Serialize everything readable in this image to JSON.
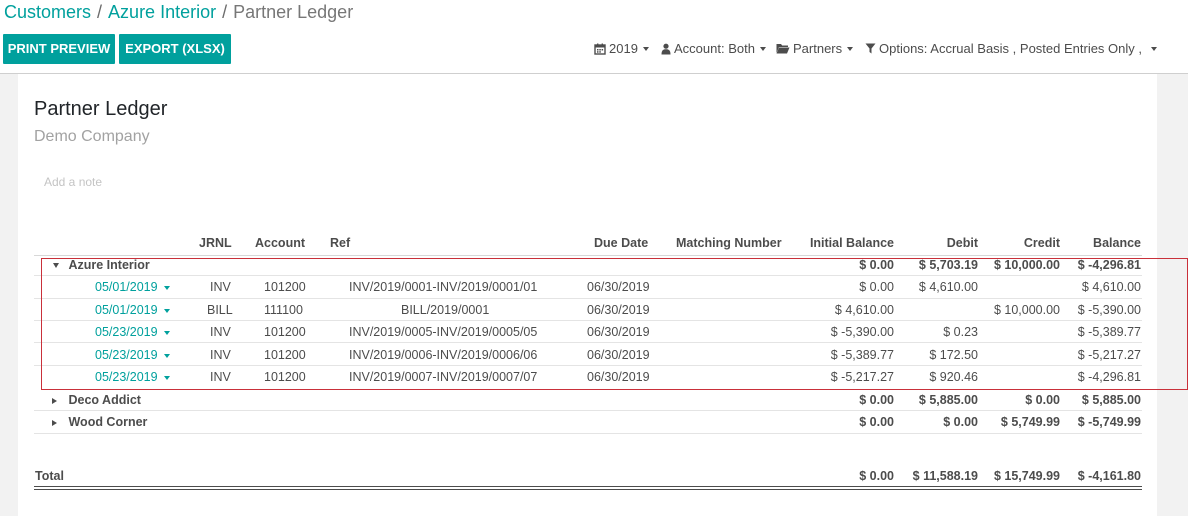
{
  "breadcrumb": {
    "items": [
      {
        "label": "Customers"
      },
      {
        "label": "Azure Interior"
      },
      {
        "label": "Partner Ledger"
      }
    ],
    "separator": "/"
  },
  "toolbar": {
    "print_preview": "PRINT PREVIEW",
    "export_xlsx": "EXPORT (XLSX)"
  },
  "filters": {
    "date": {
      "label": "2019",
      "icon": "calendar-icon"
    },
    "account": {
      "label": "Account: Both",
      "icon": "user-icon"
    },
    "partners": {
      "label": "Partners",
      "icon": "folder-icon"
    },
    "options": {
      "label": "Options: Accrual Basis , Posted Entries Only ,",
      "icon": "filter-icon"
    }
  },
  "report": {
    "title": "Partner Ledger",
    "company": "Demo Company",
    "note_placeholder": "Add a note"
  },
  "table": {
    "columns": {
      "jrnl": "JRNL",
      "account": "Account",
      "ref": "Ref",
      "due_date": "Due Date",
      "matching": "Matching Number",
      "initial": "Initial Balance",
      "debit": "Debit",
      "credit": "Credit",
      "balance": "Balance"
    },
    "groups": [
      {
        "name": "Azure Interior",
        "expanded": true,
        "initial": "$ 0.00",
        "debit": "$ 5,703.19",
        "credit": "$ 10,000.00",
        "balance": "$ -4,296.81",
        "lines": [
          {
            "date": "05/01/2019",
            "jrnl": "INV",
            "account": "101200",
            "ref": "INV/2019/0001-INV/2019/0001/01",
            "due": "06/30/2019",
            "matching": "",
            "initial": "$ 0.00",
            "debit": "$ 4,610.00",
            "credit": "",
            "balance": "$ 4,610.00"
          },
          {
            "date": "05/01/2019",
            "jrnl": "BILL",
            "account": "111100",
            "ref": "BILL/2019/0001",
            "due": "06/30/2019",
            "matching": "",
            "initial": "$ 4,610.00",
            "debit": "",
            "credit": "$ 10,000.00",
            "balance": "$ -5,390.00"
          },
          {
            "date": "05/23/2019",
            "jrnl": "INV",
            "account": "101200",
            "ref": "INV/2019/0005-INV/2019/0005/05",
            "due": "06/30/2019",
            "matching": "",
            "initial": "$ -5,390.00",
            "debit": "$ 0.23",
            "credit": "",
            "balance": "$ -5,389.77"
          },
          {
            "date": "05/23/2019",
            "jrnl": "INV",
            "account": "101200",
            "ref": "INV/2019/0006-INV/2019/0006/06",
            "due": "06/30/2019",
            "matching": "",
            "initial": "$ -5,389.77",
            "debit": "$ 172.50",
            "credit": "",
            "balance": "$ -5,217.27"
          },
          {
            "date": "05/23/2019",
            "jrnl": "INV",
            "account": "101200",
            "ref": "INV/2019/0007-INV/2019/0007/07",
            "due": "06/30/2019",
            "matching": "",
            "initial": "$ -5,217.27",
            "debit": "$ 920.46",
            "credit": "",
            "balance": "$ -4,296.81"
          }
        ]
      },
      {
        "name": "Deco Addict",
        "expanded": false,
        "initial": "$ 0.00",
        "debit": "$ 5,885.00",
        "credit": "$ 0.00",
        "balance": "$ 5,885.00"
      },
      {
        "name": "Wood Corner",
        "expanded": false,
        "initial": "$ 0.00",
        "debit": "$ 0.00",
        "credit": "$ 5,749.99",
        "balance": "$ -5,749.99"
      }
    ],
    "total": {
      "label": "Total",
      "initial": "$ 0.00",
      "debit": "$ 11,588.19",
      "credit": "$ 15,749.99",
      "balance": "$ -4,161.80"
    }
  },
  "colors": {
    "accent": "#00a09d",
    "highlight_box": "#c9303a"
  }
}
